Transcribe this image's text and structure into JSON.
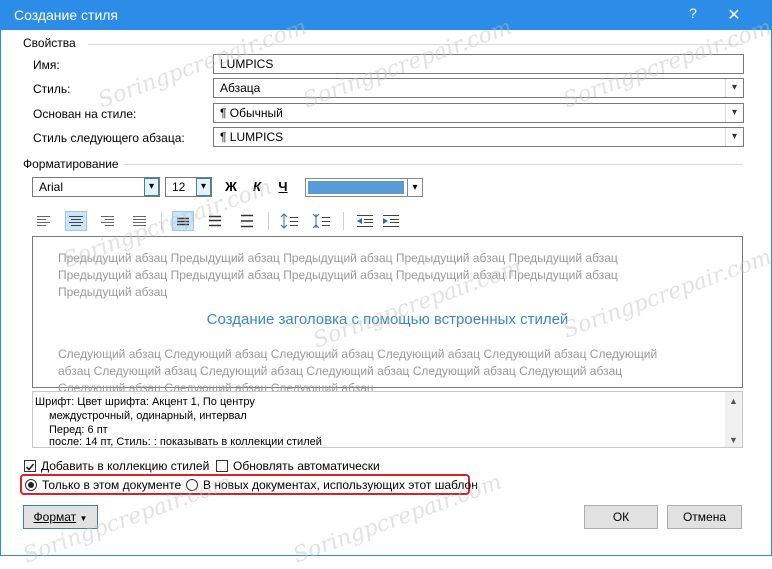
{
  "dialog": {
    "title": "Создание стиля",
    "help_glyph": "?",
    "close_glyph": "✕"
  },
  "properties": {
    "section_label": "Свойства",
    "name_label": "Имя:",
    "name_value": "LUMPICS",
    "type_label": "Стиль:",
    "type_value": "Абзаца",
    "based_on_label": "Основан на стиле:",
    "based_on_value": "¶ Обычный",
    "next_style_label": "Стиль следующего абзаца:",
    "next_style_value": "¶ LUMPICS"
  },
  "formatting": {
    "section_label": "Форматирование",
    "font": "Arial",
    "size": "12",
    "bold": "Ж",
    "italic": "К",
    "underline": "Ч",
    "font_color": "#5b9bd5"
  },
  "preview": {
    "previous_para": "Предыдущий абзац Предыдущий абзац Предыдущий абзац Предыдущий абзац Предыдущий абзац Предыдущий абзац Предыдущий абзац Предыдущий абзац Предыдущий абзац Предыдущий абзац Предыдущий абзац",
    "sample": "Создание заголовка с помощью встроенных стилей",
    "next_para": "Следующий абзац Следующий абзац Следующий абзац Следующий абзац Следующий абзац Следующий абзац Следующий абзац Следующий абзац Следующий абзац Следующий абзац Следующий абзац Следующий абзац Следующий абзац Следующий абзац"
  },
  "description": {
    "line1": "Шрифт: Цвет шрифта: Акцент 1, По центру",
    "line2": "междустрочный,  одинарный, интервал",
    "line3": "Перед:  6 пт",
    "line4": "после: 14 пт, Стиль: : показывать в коллекции стилей"
  },
  "options": {
    "add_to_gallery": "Добавить в коллекцию стилей",
    "add_to_gallery_checked": true,
    "auto_update": "Обновлять автоматически",
    "auto_update_checked": false,
    "only_this_doc": "Только в этом документе",
    "new_docs": "В новых документах, использующих этот шаблон",
    "selected_scope": "only_this_doc"
  },
  "buttons": {
    "format": "Формат",
    "ok": "ОК",
    "cancel": "Отмена"
  },
  "watermark": "Soringpcrepair.com",
  "colors": {
    "titlebar": "#2b8de8",
    "highlight": "#d9212a",
    "preview_heading": "#3c87c8"
  }
}
